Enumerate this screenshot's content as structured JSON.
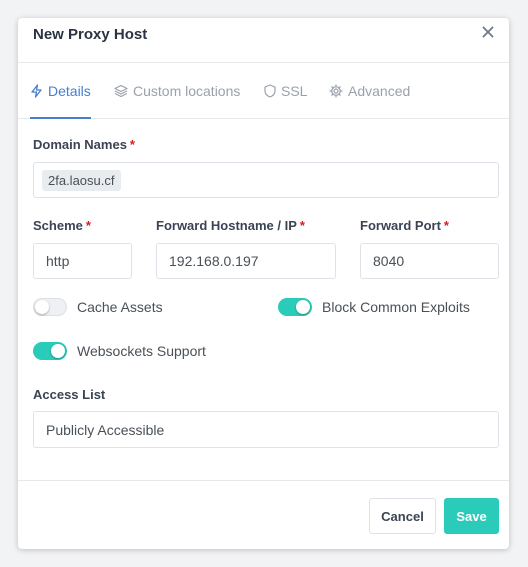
{
  "modal": {
    "title": "New Proxy Host"
  },
  "tabs": [
    {
      "label": "Details",
      "icon": "lightning-icon",
      "active": true
    },
    {
      "label": "Custom locations",
      "icon": "layers-icon",
      "active": false
    },
    {
      "label": "SSL",
      "icon": "shield-icon",
      "active": false
    },
    {
      "label": "Advanced",
      "icon": "gear-icon",
      "active": false
    }
  ],
  "form": {
    "domain_names": {
      "label": "Domain Names",
      "required": "*",
      "chips": [
        "2fa.laosu.cf"
      ]
    },
    "scheme": {
      "label": "Scheme",
      "required": "*",
      "value": "http"
    },
    "forward_host": {
      "label": "Forward Hostname / IP",
      "required": "*",
      "value": "192.168.0.197"
    },
    "forward_port": {
      "label": "Forward Port",
      "required": "*",
      "value": "8040"
    },
    "toggles": {
      "cache_assets": {
        "label": "Cache Assets",
        "enabled": false
      },
      "block_exploits": {
        "label": "Block Common Exploits",
        "enabled": true
      },
      "websockets": {
        "label": "Websockets Support",
        "enabled": true
      }
    },
    "access_list": {
      "label": "Access List",
      "value": "Publicly Accessible"
    }
  },
  "footer": {
    "cancel_label": "Cancel",
    "save_label": "Save"
  },
  "colors": {
    "accent": "#2bcbba",
    "tab_active": "#467fcf",
    "required": "#cd201f"
  }
}
